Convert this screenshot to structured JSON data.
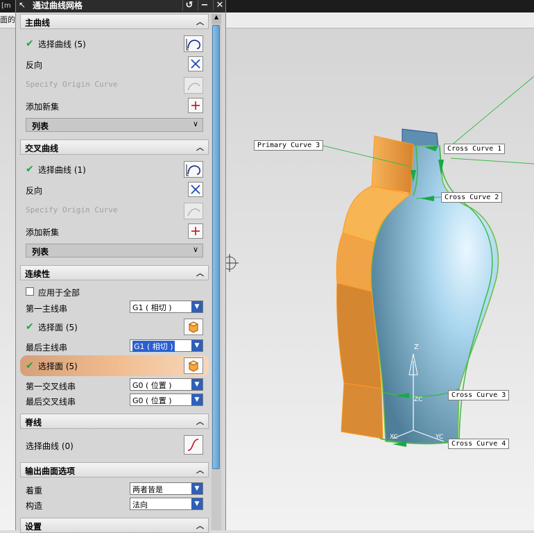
{
  "top": {
    "tabs": [
      "[m",
      "面的如"
    ]
  },
  "dialog": {
    "title": "通过曲线网格",
    "buttons": {
      "reset": "↺",
      "minimize": "−",
      "close": "✕"
    },
    "sections": {
      "primary": {
        "header": "主曲线",
        "select_label": "选择曲线 (5)",
        "reverse_label": "反向",
        "specify_label": "Specify Origin Curve",
        "add_label": "添加新集",
        "list_label": "列表"
      },
      "cross": {
        "header": "交叉曲线",
        "select_label": "选择曲线 (1)",
        "reverse_label": "反向",
        "specify_label": "Specify Origin Curve",
        "add_label": "添加新集",
        "list_label": "列表"
      },
      "continuity": {
        "header": "连续性",
        "apply_all_label": "应用于全部",
        "first_primary_label": "第一主线串",
        "first_primary_value": "G1 ( 相切 )",
        "select_face_1": "选择面 (5)",
        "last_primary_label": "最后主线串",
        "last_primary_value": "G1 ( 相切 )",
        "select_face_2": "选择面 (5)",
        "first_cross_label": "第一交叉线串",
        "first_cross_value": "G0 ( 位置 )",
        "last_cross_label": "最后交叉线串",
        "last_cross_value": "G0 ( 位置 )"
      },
      "spine": {
        "header": "脊线",
        "select_label": "选择曲线 (0)"
      },
      "output": {
        "header": "输出曲面选项",
        "emphasis_label": "着重",
        "emphasis_value": "两者皆是",
        "construct_label": "构造",
        "construct_value": "法向"
      },
      "settings": {
        "header": "设置"
      }
    }
  },
  "viewport": {
    "callouts": {
      "primary3": "Primary Curve  3",
      "cross1": "Cross Curve  1",
      "cross2": "Cross Curve  2",
      "cross3": "Cross Curve  3",
      "cross4": "Cross Curve  4"
    },
    "axes": {
      "z": "Z",
      "zc": "ZC",
      "xc": "XC",
      "yc": "YC"
    },
    "colors": {
      "orange": "#f2a54a",
      "blue_body": "#7fb7d8",
      "selection_green": "#3cb94a",
      "highlight": "#2b5fcf"
    }
  }
}
